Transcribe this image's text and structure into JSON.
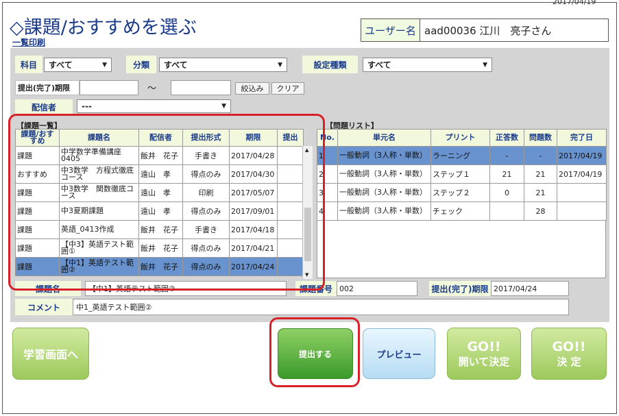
{
  "header": {
    "date": "2017/04/19",
    "title": "◇課題/おすすめを選ぶ",
    "print_link": "一覧印刷",
    "user_label": "ユーザー名",
    "user_value": "aad00036 江川　亮子さん"
  },
  "filters": {
    "subject_label": "科目",
    "subject_value": "すべて",
    "category_label": "分類",
    "category_value": "すべて",
    "setting_label": "設定種類",
    "setting_value": "すべて",
    "deadline_label": "提出(完了)期限",
    "tilde": "～",
    "narrow_button": "絞込み",
    "clear_button": "クリア",
    "sender_label": "配信者",
    "sender_value": "---"
  },
  "task_list": {
    "heading": "【課題一覧】",
    "columns": [
      "課題/おすすめ",
      "課題名",
      "配信者",
      "提出形式",
      "期限",
      "提出"
    ],
    "rows": [
      {
        "type": "課題",
        "name": "中学数学準備講座0405",
        "sender": "飯井　花子",
        "format": "手書き",
        "deadline": "2017/04/28",
        "submit": ""
      },
      {
        "type": "おすすめ",
        "name": "中3数学　方程式徹底コース",
        "sender": "遠山　孝",
        "format": "得点のみ",
        "deadline": "2017/04/30",
        "submit": ""
      },
      {
        "type": "課題",
        "name": "中3数学　関数徹底コース",
        "sender": "遠山　孝",
        "format": "印刷",
        "deadline": "2017/05/07",
        "submit": ""
      },
      {
        "type": "課題",
        "name": "中3夏期課題",
        "sender": "遠山　孝",
        "format": "得点のみ",
        "deadline": "2017/09/01",
        "submit": ""
      },
      {
        "type": "課題",
        "name": "英語_0413作成",
        "sender": "飯井　花子",
        "format": "手書き",
        "deadline": "2017/04/18",
        "submit": ""
      },
      {
        "type": "課題",
        "name": "【中3】英語テスト範囲①",
        "sender": "飯井　花子",
        "format": "得点のみ",
        "deadline": "2017/04/21",
        "submit": ""
      },
      {
        "type": "課題",
        "name": "【中1】英語テスト範囲②",
        "sender": "飯井　花子",
        "format": "得点のみ",
        "deadline": "2017/04/24",
        "submit": ""
      }
    ]
  },
  "problem_list": {
    "heading": "【問題リスト】",
    "columns": [
      "No.",
      "単元名",
      "プリント",
      "正答数",
      "問題数",
      "完了日"
    ],
    "rows": [
      {
        "no": "1",
        "unit": "一般動詞（3人称・単数）",
        "print": "ラーニング",
        "correct": "-",
        "total": "-",
        "done": "2017/04/19"
      },
      {
        "no": "2",
        "unit": "一般動詞（3人称・単数）",
        "print": "ステップ１",
        "correct": "21",
        "total": "21",
        "done": "2017/04/19"
      },
      {
        "no": "3",
        "unit": "一般動詞（3人称・単数）",
        "print": "ステップ２",
        "correct": "0",
        "total": "21",
        "done": ""
      },
      {
        "no": "4",
        "unit": "一般動詞（3人称・単数）",
        "print": "チェック",
        "correct": "",
        "total": "28",
        "done": ""
      }
    ]
  },
  "detail": {
    "name_label": "課題名",
    "name_value": "【中1】英語テスト範囲②",
    "number_label": "課題番号",
    "number_value": "002",
    "deadline_label": "提出(完了)期限",
    "deadline_value": "2017/04/24",
    "comment_label": "コメント",
    "comment_value": "中1_英語テスト範囲②"
  },
  "buttons": {
    "study": "学習画面へ",
    "submit": "提出する",
    "preview": "プレビュー",
    "go_open_1": "GO!!",
    "go_open_2": "開いて決定",
    "go_decide_1": "GO!!",
    "go_decide_2": "決 定"
  },
  "colors": {
    "accent": "#1a3a8a",
    "highlight": "#d62128",
    "selected_row": "#6893cf"
  }
}
